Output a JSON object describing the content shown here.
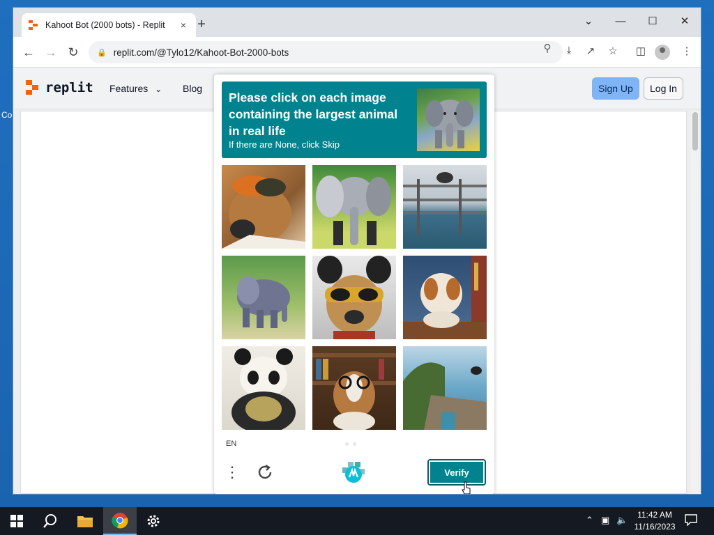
{
  "desktop": {
    "edge_text": "Co"
  },
  "browser": {
    "tab_title": "Kahoot Bot (2000 bots) - Replit",
    "tab_close": "×",
    "new_tab": "+",
    "url": "replit.com/@Tylo12/Kahoot-Bot-2000-bots",
    "controls": {
      "dropdown": "⌄",
      "minimize": "—",
      "maximize": "☐",
      "close": "✕"
    }
  },
  "site": {
    "logo_text": "replit",
    "nav": {
      "features": "Features",
      "features_caret": "⌄",
      "blog": "Blog"
    },
    "sign_up": "Sign Up",
    "log_in": "Log In",
    "brand_color": "#f26207"
  },
  "captcha": {
    "prompt": "Please click on each image containing the largest animal in real life",
    "sub": "If there are None, click Skip",
    "language": "EN",
    "verify_label": "Verify",
    "accent_color": "#00838f",
    "tiles": [
      {
        "subject": "dog-with-sunglasses"
      },
      {
        "subject": "elephant"
      },
      {
        "subject": "animal-on-fence-over-water"
      },
      {
        "subject": "elephant-in-forest"
      },
      {
        "subject": "dog-with-sunglasses"
      },
      {
        "subject": "dog-at-desk-with-glasses"
      },
      {
        "subject": "panda"
      },
      {
        "subject": "dog-with-glasses-bookshelf"
      },
      {
        "subject": "animal-jumping-over-cliff"
      }
    ]
  },
  "taskbar": {
    "time": "11:42 AM",
    "date": "11/16/2023"
  }
}
